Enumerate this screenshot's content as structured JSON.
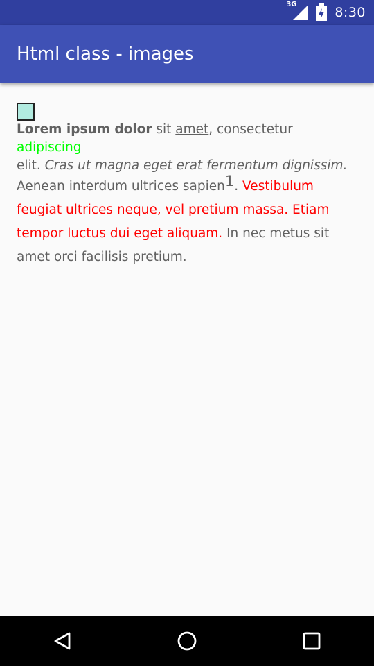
{
  "status_bar": {
    "network_label": "3G",
    "time": "8:30"
  },
  "app_bar": {
    "title": "Html class - images"
  },
  "content": {
    "segments": {
      "bold": "Lorem ipsum dolor",
      "plain1": " sit ",
      "underline": "amet",
      "plain2": ", consectetur ",
      "green": "adipiscing",
      "plain3": "elit. ",
      "italic": "Cras ut magna eget erat fermentum dignissim.",
      "plain4": "Aenean interdum ultrices sapien",
      "superscript": "1",
      "plain5": ". ",
      "red": "Vestibulum feugiat ultrices neque, vel pretium massa. Etiam tempor luctus dui eget aliquam.",
      "plain6": " In nec metus sit amet orci facilisis pretium."
    },
    "colors": {
      "text": "#616161",
      "green": "#00ff00",
      "red": "#ff0000",
      "image_fill": "#b2ebe0"
    }
  },
  "nav_bar": {
    "icons": [
      "back-icon",
      "home-icon",
      "recents-icon"
    ]
  }
}
